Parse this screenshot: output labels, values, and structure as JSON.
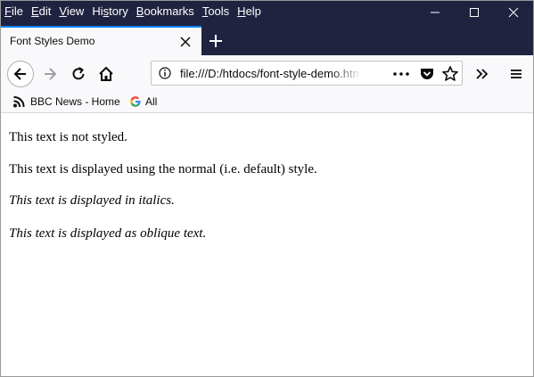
{
  "menubar": {
    "items": [
      {
        "first": "F",
        "rest": "ile"
      },
      {
        "first": "E",
        "rest": "dit"
      },
      {
        "first": "V",
        "rest": "iew"
      },
      {
        "first": "Hi",
        "under": "s",
        "rest": "tory"
      },
      {
        "first": "B",
        "rest": "ookmarks"
      },
      {
        "first": "T",
        "rest": "ools"
      },
      {
        "first": "H",
        "rest": "elp"
      }
    ]
  },
  "tab": {
    "title": "Font Styles Demo"
  },
  "urlbar": {
    "url": "file:///D:/htdocs/font-style-demo.html"
  },
  "bookmarks": [
    {
      "label": "BBC News - Home",
      "icon": "rss-icon"
    },
    {
      "label": "All",
      "icon": "google-icon"
    }
  ],
  "page": {
    "lines": [
      "This text is not styled.",
      "This text is displayed using the normal (i.e. default) style.",
      "This text is displayed in italics.",
      "This text is displayed as oblique text."
    ]
  },
  "colors": {
    "titlebar": "#202340",
    "accent": "#0a84ff",
    "toolbar": "#f9f9fb"
  }
}
